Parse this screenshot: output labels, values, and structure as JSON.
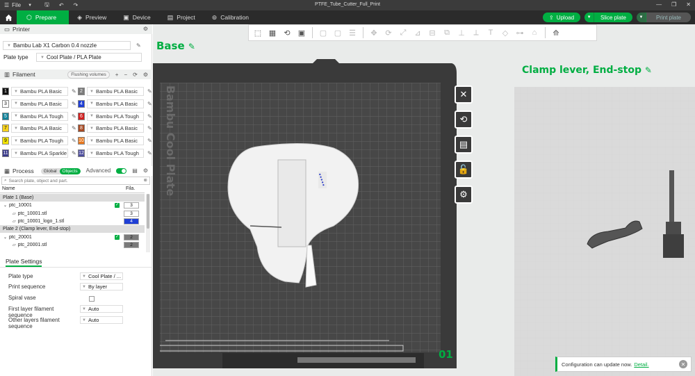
{
  "window": {
    "menu_label": "File",
    "title": "PTFE_Tube_Cutter_Full_Print"
  },
  "tabs": [
    {
      "label": "Prepare",
      "icon": "prepare-icon"
    },
    {
      "label": "Preview",
      "icon": "preview-icon"
    },
    {
      "label": "Device",
      "icon": "device-icon"
    },
    {
      "label": "Project",
      "icon": "project-icon"
    },
    {
      "label": "Calibration",
      "icon": "calibration-icon"
    }
  ],
  "actions": {
    "upload": "Upload",
    "slice": "Slice plate",
    "print": "Print plate"
  },
  "printer": {
    "section_title": "Printer",
    "model": "Bambu Lab X1 Carbon 0.4 nozzle",
    "plate_type_label": "Plate type",
    "plate_type_value": "Cool Plate / PLA Plate"
  },
  "filament": {
    "section_title": "Filament",
    "flushing_label": "Flushing volumes",
    "items": [
      {
        "num": "1",
        "name": "Bambu PLA Basic",
        "color": "#111111"
      },
      {
        "num": "2",
        "name": "Bambu PLA Basic",
        "color": "#7a7a7a"
      },
      {
        "num": "3",
        "name": "Bambu PLA Basic",
        "color": "#ffffff"
      },
      {
        "num": "4",
        "name": "Bambu PLA Basic",
        "color": "#1f3fd6"
      },
      {
        "num": "5",
        "name": "Bambu PLA Tough",
        "color": "#13829a"
      },
      {
        "num": "6",
        "name": "Bambu PLA Tough",
        "color": "#d21f1f"
      },
      {
        "num": "7",
        "name": "Bambu PLA Basic",
        "color": "#f6d11c"
      },
      {
        "num": "8",
        "name": "Bambu PLA Basic",
        "color": "#a84a24"
      },
      {
        "num": "9",
        "name": "Bambu PLA Tough",
        "color": "#f2e400"
      },
      {
        "num": "10",
        "name": "Bambu PLA Basic",
        "color": "#e8781e"
      },
      {
        "num": "11",
        "name": "Bambu PLA Sparkle",
        "color": "#3a3a8a"
      },
      {
        "num": "12",
        "name": "Bambu PLA Tough",
        "color": "#4d4d9d"
      }
    ]
  },
  "process": {
    "section_title": "Process",
    "global_label": "Global",
    "objects_label": "Objects",
    "advanced_label": "Advanced",
    "search_placeholder": "Search plate, object and part.",
    "col_name": "Name",
    "col_fila": "Fila.",
    "rows": [
      {
        "type": "plate",
        "label": "Plate 1 (Base)"
      },
      {
        "type": "object",
        "label": "ptc_10001",
        "fila": "3",
        "checked": true
      },
      {
        "type": "part",
        "label": "ptc_10001.stl",
        "fila": "3"
      },
      {
        "type": "part",
        "label": "ptc_10001_logo_1.stl",
        "fila": "4"
      },
      {
        "type": "plate",
        "label": "Plate 2 (Clamp lever, End-stop)"
      },
      {
        "type": "object",
        "label": "ptc_20001",
        "fila": "2",
        "checked": true
      },
      {
        "type": "part",
        "label": "ptc_20001.stl",
        "fila": "2"
      }
    ]
  },
  "plate_settings": {
    "title": "Plate Settings",
    "rows": [
      {
        "label": "Plate type",
        "value": "Cool Plate / ..."
      },
      {
        "label": "Print sequence",
        "value": "By layer"
      },
      {
        "label": "Spiral vase",
        "value": ""
      },
      {
        "label": "First layer filament sequence",
        "value": "Auto"
      },
      {
        "label": "Other layers filament sequence",
        "value": "Auto"
      }
    ]
  },
  "viewport": {
    "plate1_name": "Base",
    "plate2_name": "Clamp lever, End-stop",
    "plate_number": "01",
    "bed_label": "Bambu Cool Plate"
  },
  "notification": {
    "text": "Configuration can update now.",
    "link": "Detail."
  }
}
